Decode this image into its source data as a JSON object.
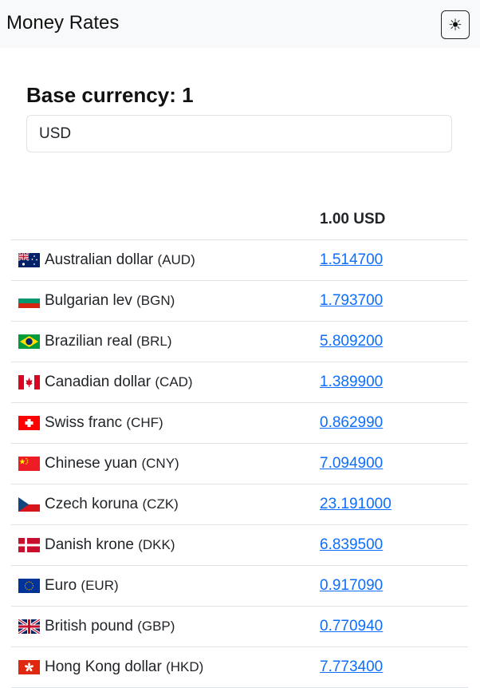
{
  "navbar": {
    "title": "Money Rates",
    "theme_toggle_icon": "☀"
  },
  "base": {
    "title": "Base currency: 1",
    "input_value": "USD"
  },
  "table": {
    "header_rate": "1.00 USD",
    "rows": [
      {
        "name": "Australian dollar",
        "code": "(AUD)",
        "rate": "1.514700",
        "flag": "au-flag"
      },
      {
        "name": "Bulgarian lev",
        "code": "(BGN)",
        "rate": "1.793700",
        "flag": "bg-flag"
      },
      {
        "name": "Brazilian real",
        "code": "(BRL)",
        "rate": "5.809200",
        "flag": "br-flag"
      },
      {
        "name": "Canadian dollar",
        "code": "(CAD)",
        "rate": "1.389900",
        "flag": "ca-flag"
      },
      {
        "name": "Swiss franc",
        "code": "(CHF)",
        "rate": "0.862990",
        "flag": "ch-flag"
      },
      {
        "name": "Chinese yuan",
        "code": "(CNY)",
        "rate": "7.094900",
        "flag": "cn-flag"
      },
      {
        "name": "Czech koruna",
        "code": "(CZK)",
        "rate": "23.191000",
        "flag": "cz-flag"
      },
      {
        "name": "Danish krone",
        "code": "(DKK)",
        "rate": "6.839500",
        "flag": "dk-flag"
      },
      {
        "name": "Euro",
        "code": "(EUR)",
        "rate": "0.917090",
        "flag": "eu-flag"
      },
      {
        "name": "British pound",
        "code": "(GBP)",
        "rate": "0.770940",
        "flag": "gb-flag"
      },
      {
        "name": "Hong Kong dollar",
        "code": "(HKD)",
        "rate": "7.773400",
        "flag": "hk-flag"
      }
    ]
  }
}
